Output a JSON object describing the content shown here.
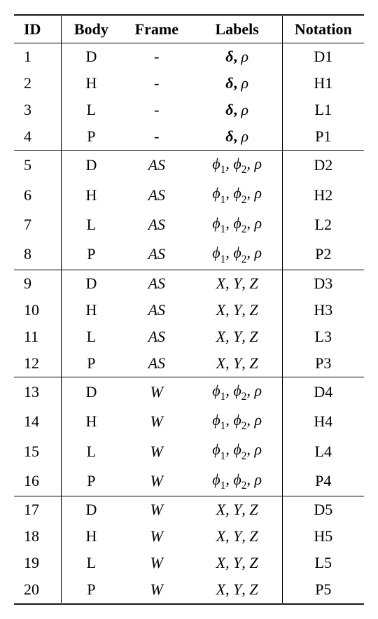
{
  "headers": {
    "id": "ID",
    "body": "Body",
    "frame": "Frame",
    "labels": "Labels",
    "notation": "Notation"
  },
  "rows": [
    {
      "id": "1",
      "body": "D",
      "frame": "-",
      "labels": "δ, ρ",
      "labels_fmt": "bold_delta_rho",
      "notation": "D1",
      "sep": false
    },
    {
      "id": "2",
      "body": "H",
      "frame": "-",
      "labels": "δ, ρ",
      "labels_fmt": "bold_delta_rho",
      "notation": "H1",
      "sep": false
    },
    {
      "id": "3",
      "body": "L",
      "frame": "-",
      "labels": "δ, ρ",
      "labels_fmt": "bold_delta_rho",
      "notation": "L1",
      "sep": false
    },
    {
      "id": "4",
      "body": "P",
      "frame": "-",
      "labels": "δ, ρ",
      "labels_fmt": "bold_delta_rho",
      "notation": "P1",
      "sep": false
    },
    {
      "id": "5",
      "body": "D",
      "frame": "AS",
      "labels": "φ1, φ2, ρ",
      "labels_fmt": "phi_rho",
      "notation": "D2",
      "sep": true
    },
    {
      "id": "6",
      "body": "H",
      "frame": "AS",
      "labels": "φ1, φ2, ρ",
      "labels_fmt": "phi_rho",
      "notation": "H2",
      "sep": false
    },
    {
      "id": "7",
      "body": "L",
      "frame": "AS",
      "labels": "φ1, φ2, ρ",
      "labels_fmt": "phi_rho",
      "notation": "L2",
      "sep": false
    },
    {
      "id": "8",
      "body": "P",
      "frame": "AS",
      "labels": "φ1, φ2, ρ",
      "labels_fmt": "phi_rho",
      "notation": "P2",
      "sep": false
    },
    {
      "id": "9",
      "body": "D",
      "frame": "AS",
      "labels": "X, Y, Z",
      "labels_fmt": "xyz",
      "notation": "D3",
      "sep": true
    },
    {
      "id": "10",
      "body": "H",
      "frame": "AS",
      "labels": "X, Y, Z",
      "labels_fmt": "xyz",
      "notation": "H3",
      "sep": false
    },
    {
      "id": "11",
      "body": "L",
      "frame": "AS",
      "labels": "X, Y, Z",
      "labels_fmt": "xyz",
      "notation": "L3",
      "sep": false
    },
    {
      "id": "12",
      "body": "P",
      "frame": "AS",
      "labels": "X, Y, Z",
      "labels_fmt": "xyz",
      "notation": "P3",
      "sep": false
    },
    {
      "id": "13",
      "body": "D",
      "frame": "W",
      "labels": "φ1, φ2, ρ",
      "labels_fmt": "phi_rho",
      "notation": "D4",
      "sep": true
    },
    {
      "id": "14",
      "body": "H",
      "frame": "W",
      "labels": "φ1, φ2, ρ",
      "labels_fmt": "phi_rho",
      "notation": "H4",
      "sep": false
    },
    {
      "id": "15",
      "body": "L",
      "frame": "W",
      "labels": "φ1, φ2, ρ",
      "labels_fmt": "phi_rho",
      "notation": "L4",
      "sep": false
    },
    {
      "id": "16",
      "body": "P",
      "frame": "W",
      "labels": "φ1, φ2, ρ",
      "labels_fmt": "phi_rho",
      "notation": "P4",
      "sep": false
    },
    {
      "id": "17",
      "body": "D",
      "frame": "W",
      "labels": "X, Y, Z",
      "labels_fmt": "xyz",
      "notation": "D5",
      "sep": true
    },
    {
      "id": "18",
      "body": "H",
      "frame": "W",
      "labels": "X, Y, Z",
      "labels_fmt": "xyz",
      "notation": "H5",
      "sep": false
    },
    {
      "id": "19",
      "body": "L",
      "frame": "W",
      "labels": "X, Y, Z",
      "labels_fmt": "xyz",
      "notation": "L5",
      "sep": false
    },
    {
      "id": "20",
      "body": "P",
      "frame": "W",
      "labels": "X, Y, Z",
      "labels_fmt": "xyz",
      "notation": "P5",
      "sep": false
    }
  ]
}
